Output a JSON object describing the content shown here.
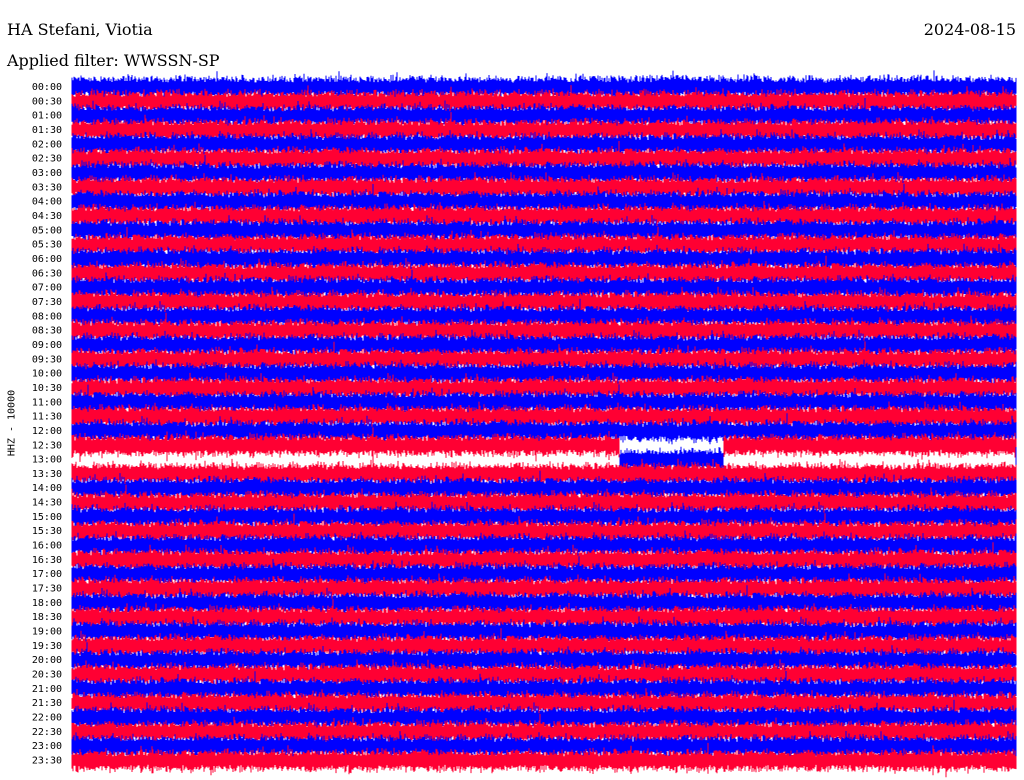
{
  "header": {
    "station": "HA Stefani, Viotia",
    "date": "2024-08-15",
    "filter": "Applied filter: WWSSN-SP"
  },
  "channel_label": "HHZ - 10000",
  "colors": {
    "blue": "#0000ff",
    "red": "#ff0033",
    "background": "#ffffff"
  },
  "chart_data": {
    "type": "helicorder",
    "row_labels": [
      "00:00",
      "00:30",
      "01:00",
      "01:30",
      "02:00",
      "02:30",
      "03:00",
      "03:30",
      "04:00",
      "04:30",
      "05:00",
      "05:30",
      "06:00",
      "06:30",
      "07:00",
      "07:30",
      "08:00",
      "08:30",
      "09:00",
      "09:30",
      "10:00",
      "10:30",
      "11:00",
      "11:30",
      "12:00",
      "12:30",
      "13:00",
      "13:30",
      "14:00",
      "14:30",
      "15:00",
      "15:30",
      "16:00",
      "16:30",
      "17:00",
      "17:30",
      "18:00",
      "18:30",
      "19:00",
      "19:30",
      "20:00",
      "20:30",
      "21:00",
      "21:30",
      "22:00",
      "22:30",
      "23:00",
      "23:30"
    ],
    "row_minutes": 30,
    "trace_colors": [
      "blue",
      "red"
    ],
    "gaps": [
      {
        "row": "12:30",
        "from_fraction": 0.58,
        "to_fraction": 0.69
      },
      {
        "row": "13:00",
        "from_fraction": 0.0,
        "to_fraction": 0.58
      },
      {
        "row": "13:00",
        "from_fraction": 0.69,
        "to_fraction": 1.0
      }
    ]
  }
}
